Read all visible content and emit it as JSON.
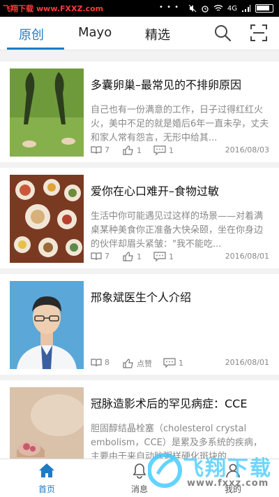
{
  "status_bar": {
    "watermark_name": "飞翔下载",
    "watermark_url": "www.FXXZ.com",
    "dots": "• • •",
    "signal_text": "4G",
    "icons": [
      "mute-icon",
      "alarm-icon",
      "wifi-icon",
      "signal-icon",
      "battery-icon"
    ]
  },
  "header": {
    "tabs": [
      {
        "label": "原创",
        "active": true
      },
      {
        "label": "Mayo",
        "active": false
      },
      {
        "label": "精选",
        "active": false
      }
    ],
    "accent_color": "#1e7bc6",
    "icons": [
      "search-icon",
      "scan-icon"
    ]
  },
  "articles": [
    {
      "title": "多囊卵巢–最常见的不排卵原因",
      "excerpt": "自己也有一份满意的工作，日子过得红红火火，美中不足的就是婚后6年一直未孕，丈夫和家人常有怨言，无形中给其...",
      "reads": "7",
      "likes": "1",
      "comments": "1",
      "date": "2016/08/03"
    },
    {
      "title": "爱你在心口难开–食物过敏",
      "excerpt": "生活中你可能遇见过这样的场景——对着满桌某种美食你正准备大快朵颐，坐在你身边的伙伴却眉头紧皱：\"我不能吃...",
      "reads": "7",
      "likes": "1",
      "comments": "1",
      "date": "2016/08/01"
    },
    {
      "title": "邢象斌医生个人介绍",
      "excerpt": "",
      "reads": "8",
      "likes": "点赞",
      "comments": "1",
      "date": "2016/08/01"
    },
    {
      "title": "冠脉造影术后的罕见病症：CCE",
      "excerpt": "胆固醇结晶栓塞（cholesterol crystal embolism，CCE）是累及多系统的疾病，主要由于来自动脉粥样硬化斑块的...",
      "reads": "",
      "likes": "",
      "comments": "",
      "date": ""
    }
  ],
  "bottom_nav": [
    {
      "label": "首页",
      "icon": "home-icon",
      "active": true
    },
    {
      "label": "消息",
      "icon": "bell-icon",
      "active": false
    },
    {
      "label": "我的",
      "icon": "profile-icon",
      "active": false
    }
  ],
  "watermark": {
    "brand": "飞翔下载",
    "url": "www.fxxz.com"
  }
}
